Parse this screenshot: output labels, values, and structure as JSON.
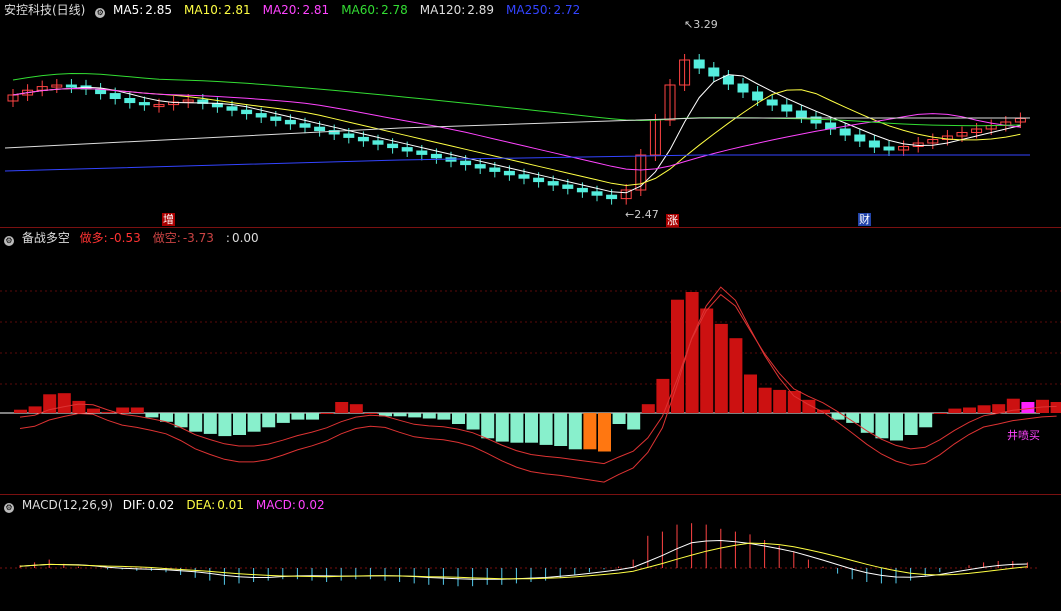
{
  "main": {
    "title": "安控科技(日线)",
    "ma": [
      {
        "label": "MA5:",
        "value": "2.85",
        "color": "#ffffff"
      },
      {
        "label": "MA10:",
        "value": "2.81",
        "color": "#ffff44"
      },
      {
        "label": "MA20:",
        "value": "2.81",
        "color": "#ff44ff"
      },
      {
        "label": "MA60:",
        "value": "2.78",
        "color": "#33dd33"
      },
      {
        "label": "MA120:",
        "value": "2.89",
        "color": "#dddddd"
      },
      {
        "label": "MA250:",
        "value": "2.72",
        "color": "#3344ff"
      }
    ],
    "high_label": "3.29",
    "low_label": "2.47",
    "tags": [
      {
        "text": "增",
        "color": "#ffffff",
        "bg": "#aa0000"
      },
      {
        "text": "涨",
        "color": "#ffffff",
        "bg": "#aa0000"
      },
      {
        "text": "财",
        "color": "#ffffff",
        "bg": "#2244aa"
      }
    ]
  },
  "ind": {
    "title": "备战多空",
    "items": [
      {
        "label": "做多:",
        "value": "-0.53",
        "color": "#ff3333"
      },
      {
        "label": "做空:",
        "value": "-3.73",
        "color": "#cc4444"
      },
      {
        "label": ":",
        "value": "0.00",
        "color": "#dddddd"
      }
    ],
    "signal": "井喷买",
    "bars": [
      0.3,
      0.6,
      1.7,
      1.8,
      1.1,
      0.4,
      0.1,
      0.5,
      0.5,
      -0.4,
      -0.8,
      -1.3,
      -1.7,
      -1.9,
      -2.1,
      -2.0,
      -1.7,
      -1.3,
      -0.9,
      -0.6,
      -0.6,
      0,
      1.0,
      0.8,
      0,
      -0.3,
      -0.3,
      -0.4,
      -0.5,
      -0.6,
      -1.0,
      -1.5,
      -2.3,
      -2.6,
      -2.7,
      -2.7,
      -2.9,
      -3.0,
      -3.3,
      -3.3,
      -3.5,
      -1.0,
      -1.5,
      0.8,
      3.1,
      10.3,
      11.0,
      9.5,
      8.1,
      6.8,
      3.5,
      2.3,
      2.1,
      2.0,
      1.2,
      0.3,
      -0.6,
      -0.9,
      -1.8,
      -2.3,
      -2.5,
      -2.0,
      -1.3,
      0,
      0.4,
      0.5,
      0.7,
      0.8,
      1.3,
      1.0,
      1.2,
      1.0
    ]
  },
  "macd": {
    "title": "MACD(12,26,9)",
    "items": [
      {
        "label": "DIF:",
        "value": "0.02",
        "color": "#ffffff"
      },
      {
        "label": "DEA:",
        "value": "0.01",
        "color": "#ffff44"
      },
      {
        "label": "MACD:",
        "value": "0.02",
        "color": "#ff44ff"
      }
    ],
    "bars": [
      0.2,
      0.4,
      0.6,
      0.3,
      0.1,
      0.0,
      -0.1,
      -0.1,
      -0.2,
      -0.2,
      -0.3,
      -0.5,
      -0.7,
      -0.9,
      -1.2,
      -1.1,
      -1.0,
      -0.9,
      -0.8,
      -0.8,
      -0.9,
      -1.0,
      -0.9,
      -0.8,
      -0.8,
      -0.9,
      -1.0,
      -1.1,
      -1.2,
      -1.2,
      -1.3,
      -1.3,
      -1.2,
      -1.2,
      -1.1,
      -1.0,
      -0.9,
      -0.7,
      -0.5,
      -0.3,
      -0.1,
      0.1,
      0.6,
      2.3,
      2.6,
      3.1,
      3.2,
      3.1,
      2.8,
      2.6,
      2.4,
      2.0,
      1.6,
      1.2,
      0.6,
      0.1,
      -0.4,
      -0.8,
      -1.0,
      -1.1,
      -1.1,
      -0.9,
      -0.6,
      -0.3,
      0.0,
      0.2,
      0.4,
      0.5,
      0.5,
      0.4
    ]
  }
}
